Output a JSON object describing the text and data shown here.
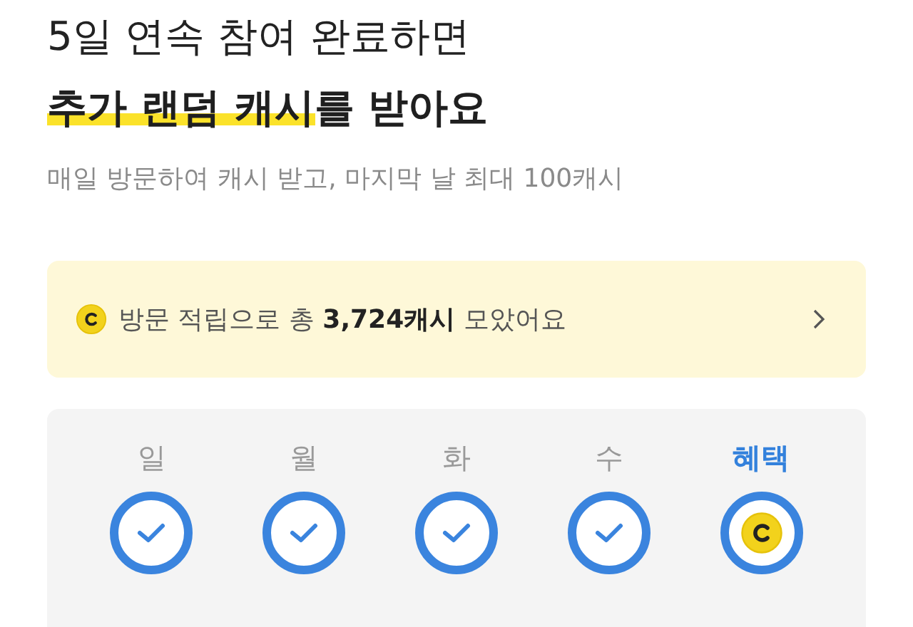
{
  "headline": {
    "line1": "5일 연속 참여 완료하면",
    "highlight": "추가 랜덤 캐시",
    "rest": "를 받아요"
  },
  "subtitle": "매일 방문하여 캐시 받고, 마지막 날 최대 100캐시",
  "summary": {
    "text": "방문 적립으로 총 **3,724캐시** 모았어요"
  },
  "days": [
    {
      "label": "일",
      "kind": "day",
      "checked": true
    },
    {
      "label": "월",
      "kind": "day",
      "checked": true
    },
    {
      "label": "화",
      "kind": "day",
      "checked": true
    },
    {
      "label": "수",
      "kind": "day",
      "checked": true
    },
    {
      "label": "혜택",
      "kind": "reward",
      "checked": false
    }
  ]
}
